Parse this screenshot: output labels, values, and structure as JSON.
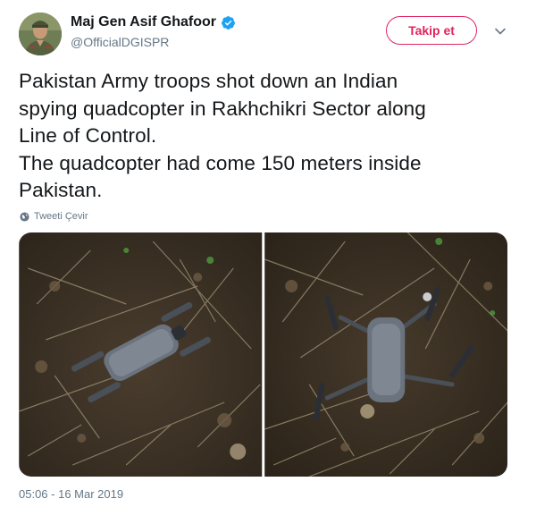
{
  "user": {
    "display_name": "Maj Gen Asif Ghafoor",
    "handle": "@OfficialDGISPR",
    "verified": true,
    "avatar_icon": "profile-photo-icon"
  },
  "actions": {
    "follow_label": "Takip et",
    "menu_icon": "chevron-down-icon"
  },
  "tweet": {
    "lines": [
      "Pakistan Army troops shot down an Indian",
      "spying quadcopter in Rakhchikri Sector along",
      "Line of Control.",
      "The quadcopter had come 150 meters inside",
      "Pakistan."
    ],
    "translate_label": "Tweeti Çevir",
    "timestamp": "05:06 - 16 Mar 2019"
  },
  "media": {
    "photo_count": 2
  },
  "colors": {
    "accent": "#e0245e",
    "verified": "#1da1f2",
    "secondary_text": "#657786",
    "text": "#14171a"
  }
}
